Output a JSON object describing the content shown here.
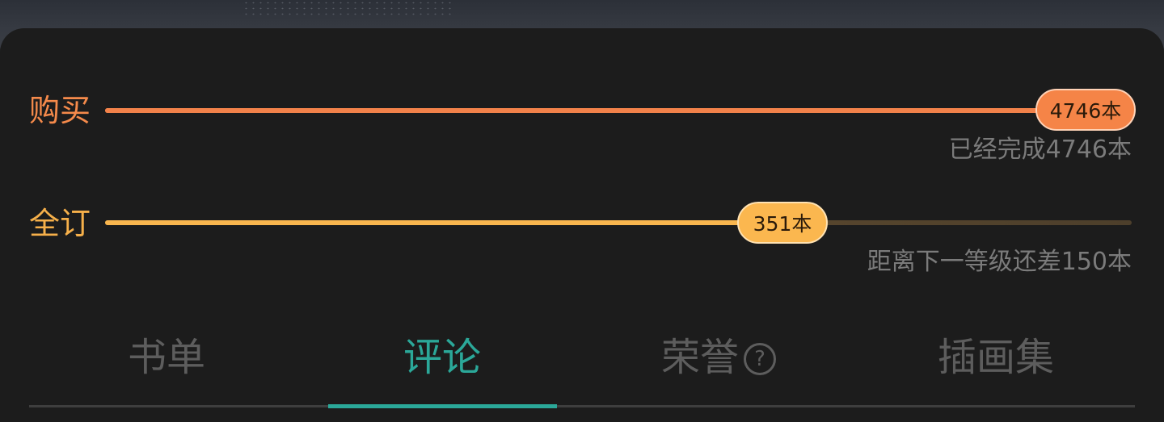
{
  "purchase": {
    "label": "购买",
    "badge": "4746本",
    "note": "已经完成4746本",
    "progress_fraction": 1.0,
    "color": "#f2824a"
  },
  "full_subscription": {
    "label": "全订",
    "badge": "351本",
    "note": "距离下一等级还差150本",
    "progress_fraction": 0.7,
    "color": "#f9b64e"
  },
  "tabs": [
    {
      "label": "书单",
      "active": false
    },
    {
      "label": "评论",
      "active": true
    },
    {
      "label": "荣誉",
      "active": false,
      "icon": "question-circle-icon",
      "icon_glyph": "?"
    },
    {
      "label": "插画集",
      "active": false
    }
  ],
  "colors": {
    "accent_teal": "#2ba899",
    "panel_bg": "#1c1c1c",
    "muted_text": "#7b7b7b"
  }
}
